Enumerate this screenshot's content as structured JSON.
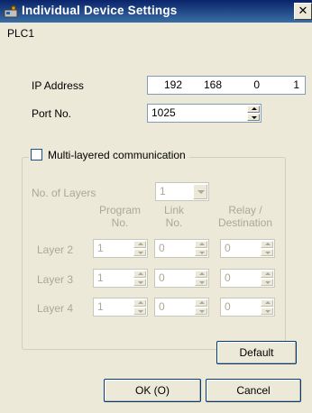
{
  "window": {
    "title": "Individual Device Settings",
    "close_glyph": "✕",
    "icon": "device-settings-icon"
  },
  "device_name": "PLC1",
  "ip_address": {
    "label": "IP Address",
    "octets": [
      "192",
      "168",
      "0",
      "1"
    ]
  },
  "port": {
    "label": "Port No.",
    "value": "1025"
  },
  "multi_layer": {
    "label": "Multi-layered communication",
    "checked": false,
    "layers_label": "No. of Layers",
    "layers_value": "1",
    "col_program": [
      "Program",
      "No."
    ],
    "col_link": [
      "Link",
      "No."
    ],
    "col_relay": [
      "Relay /",
      "Destination"
    ],
    "rows": [
      {
        "label": "Layer 2",
        "program": "1",
        "link": "0",
        "relay": "0"
      },
      {
        "label": "Layer 3",
        "program": "1",
        "link": "0",
        "relay": "0"
      },
      {
        "label": "Layer 4",
        "program": "1",
        "link": "0",
        "relay": "0"
      }
    ]
  },
  "buttons": {
    "default": "Default",
    "ok": "OK (O)",
    "cancel": "Cancel"
  }
}
